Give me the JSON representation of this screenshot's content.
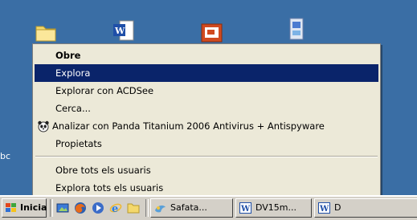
{
  "desktop": {
    "partial_label": "bc",
    "icons": [
      "folder-icon",
      "word-document-icon",
      "powerpoint-icon",
      "setup-installer-icon"
    ]
  },
  "context_menu": {
    "items": [
      {
        "label": "Obre",
        "style": "bold"
      },
      {
        "label": "Explora",
        "style": "highlighted"
      },
      {
        "label": "Explorar con ACDSee"
      },
      {
        "label": "Cerca..."
      },
      {
        "label": "Analizar con Panda Titanium 2006 Antivirus + Antispyware",
        "icon": "panda-icon"
      },
      {
        "label": "Propietats"
      },
      {
        "label": "Obre tots els usuaris"
      },
      {
        "label": "Explora tots els usuaris"
      }
    ]
  },
  "taskbar": {
    "start_label": "Inicia",
    "quick_launch": [
      "show-desktop-icon",
      "firefox-icon",
      "media-player-icon",
      "internet-explorer-icon",
      "folder-icon"
    ],
    "tasks": [
      {
        "label": "Safata...",
        "icon": "safata-icon"
      },
      {
        "label": "DV15m...",
        "icon": "word-icon"
      },
      {
        "label": "D",
        "icon": "word-icon"
      }
    ]
  },
  "colors": {
    "desktop": "#3a6ea5",
    "menu_bg": "#ece9d8",
    "highlight": "#0a246a",
    "taskbar": "#d4d0c8"
  }
}
